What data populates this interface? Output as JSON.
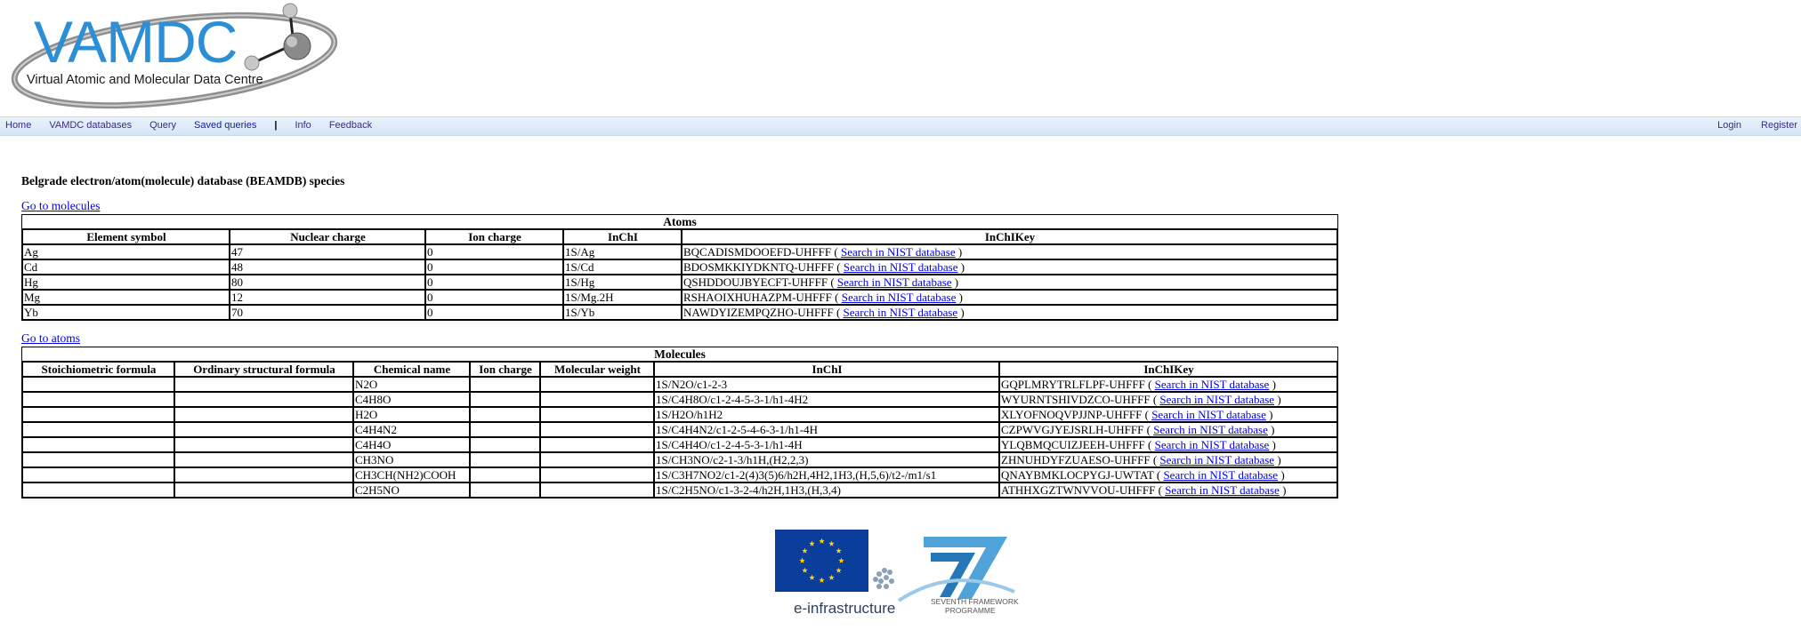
{
  "header": {
    "logo_title": "VAMDC",
    "logo_subtitle": "Virtual Atomic and Molecular Data Centre"
  },
  "nav": {
    "left": [
      {
        "label": "Home"
      },
      {
        "label": "VAMDC databases"
      },
      {
        "label": "Query"
      },
      {
        "label": "Saved queries"
      }
    ],
    "separator": "|",
    "left_after": [
      {
        "label": "Info"
      },
      {
        "label": "Feedback"
      }
    ],
    "right": [
      {
        "label": "Login"
      },
      {
        "label": "Register"
      }
    ]
  },
  "page": {
    "title": "Belgrade electron/atom(molecule) database (BEAMDB) species",
    "go_to_molecules": "Go to molecules",
    "go_to_atoms": "Go to atoms"
  },
  "atoms": {
    "caption": "Atoms",
    "columns": [
      "Element symbol",
      "Nuclear charge",
      "Ion charge",
      "InChI",
      "InChIKey"
    ],
    "link_label": "Search in NIST database",
    "rows": [
      {
        "symbol": "Ag",
        "nuclear": "47",
        "ion": "0",
        "inchi": "1S/Ag",
        "key": "BQCADISMDOOEFD-UHFFF"
      },
      {
        "symbol": "Cd",
        "nuclear": "48",
        "ion": "0",
        "inchi": "1S/Cd",
        "key": "BDOSMKKIYDKNTQ-UHFFF"
      },
      {
        "symbol": "Hg",
        "nuclear": "80",
        "ion": "0",
        "inchi": "1S/Hg",
        "key": "QSHDDOUJBYECFT-UHFFF"
      },
      {
        "symbol": "Mg",
        "nuclear": "12",
        "ion": "0",
        "inchi": "1S/Mg.2H",
        "key": "RSHAOIXHUHAZPM-UHFFF"
      },
      {
        "symbol": "Yb",
        "nuclear": "70",
        "ion": "0",
        "inchi": "1S/Yb",
        "key": "NAWDYIZEMPQZHO-UHFFF"
      }
    ]
  },
  "molecules": {
    "caption": "Molecules",
    "columns": [
      "Stoichiometric formula",
      "Ordinary structural formula",
      "Chemical name",
      "Ion charge",
      "Molecular weight",
      "InChI",
      "InChIKey"
    ],
    "link_label": "Search in NIST database",
    "rows": [
      {
        "name": "N2O",
        "inchi": "1S/N2O/c1-2-3",
        "key": "GQPLMRYTRLFLPF-UHFFF"
      },
      {
        "name": "C4H8O",
        "inchi": "1S/C4H8O/c1-2-4-5-3-1/h1-4H2",
        "key": "WYURNTSHIVDZCO-UHFFF"
      },
      {
        "name": "H2O",
        "inchi": "1S/H2O/h1H2",
        "key": "XLYOFNOQVPJJNP-UHFFF"
      },
      {
        "name": "C4H4N2",
        "inchi": "1S/C4H4N2/c1-2-5-4-6-3-1/h1-4H",
        "key": "CZPWVGJYEJSRLH-UHFFF"
      },
      {
        "name": "C4H4O",
        "inchi": "1S/C4H4O/c1-2-4-5-3-1/h1-4H",
        "key": "YLQBMQCUIZJEEH-UHFFF"
      },
      {
        "name": "CH3NO",
        "inchi": "1S/CH3NO/c2-1-3/h1H,(H2,2,3)",
        "key": "ZHNUHDYFZUAESO-UHFFF"
      },
      {
        "name": "CH3CH(NH2)COOH",
        "inchi": "1S/C3H7NO2/c1-2(4)3(5)6/h2H,4H2,1H3,(H,5,6)/t2-/m1/s1",
        "key": "QNAYBMKLOCPYGJ-UWTAT"
      },
      {
        "name": "C2H5NO",
        "inchi": "1S/C2H5NO/c1-3-2-4/h2H,1H3,(H,3,4)",
        "key": "ATHHXGZTWNVVOU-UHFFF"
      }
    ]
  },
  "footer": {
    "eu_label": "e-infrastructure",
    "fp7_line1": "SEVENTH FRAMEWORK",
    "fp7_line2": "PROGRAMME"
  },
  "colors": {
    "nav_gradient_top": "#eaf2fb",
    "nav_gradient_bottom": "#d5e5f6",
    "nav_link": "#3b2a87",
    "link_blue": "#0000ee",
    "logo_blue": "#2b8fd6",
    "eu_blue": "#0b3e9a",
    "eu_star": "#ffd200"
  }
}
